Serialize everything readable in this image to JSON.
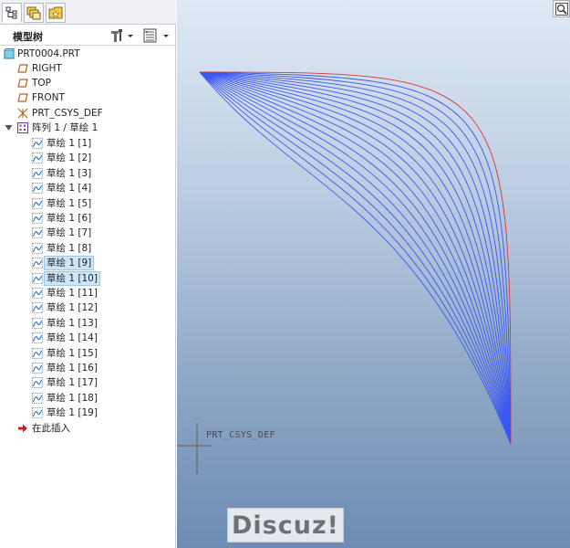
{
  "tree_header": {
    "title": "模型树"
  },
  "tree": {
    "root": "PRT0004.PRT",
    "datum_planes": [
      "RIGHT",
      "TOP",
      "FRONT"
    ],
    "csys": "PRT_CSYS_DEF",
    "pattern": "阵列 1 / 草绘 1",
    "sketches": [
      "草绘 1 [1]",
      "草绘 1 [2]",
      "草绘 1 [3]",
      "草绘 1 [4]",
      "草绘 1 [5]",
      "草绘 1 [6]",
      "草绘 1 [7]",
      "草绘 1 [8]",
      "草绘 1 [9]",
      "草绘 1 [10]",
      "草绘 1 [11]",
      "草绘 1 [12]",
      "草绘 1 [13]",
      "草绘 1 [14]",
      "草绘 1 [15]",
      "草绘 1 [16]",
      "草绘 1 [17]",
      "草绘 1 [18]",
      "草绘 1 [19]"
    ],
    "selected_sketch_indices": [
      8,
      9
    ],
    "insert_here": "在此插入"
  },
  "viewport": {
    "csys_label": "PRT_CSYS_DEF",
    "curve_count": 19,
    "curve_color": "#3b57f0",
    "highlight_curve_color": "#e0303a"
  },
  "watermark": {
    "text": "Discuz!"
  },
  "icons": {
    "tab1": "model-tree-icon",
    "tab2": "layers-icon",
    "tab3": "favorites-icon",
    "settings": "tree-settings-icon",
    "filter": "tree-filter-icon",
    "zoom": "zoom-fit-icon"
  }
}
